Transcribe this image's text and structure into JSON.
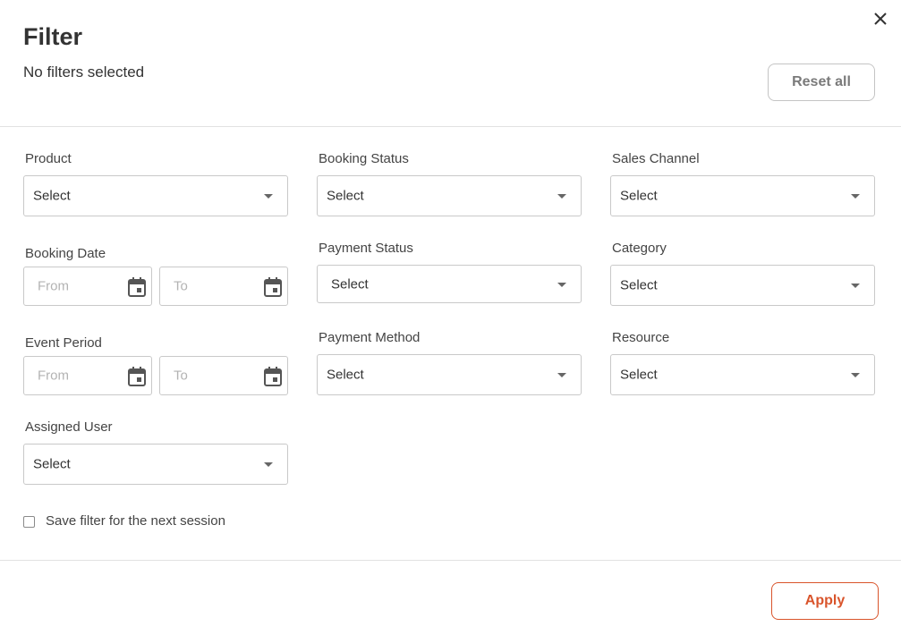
{
  "header": {
    "title": "Filter",
    "subtitle": "No filters selected",
    "reset_label": "Reset all"
  },
  "fields": {
    "product": {
      "label": "Product",
      "value": "Select"
    },
    "booking_status": {
      "label": "Booking Status",
      "value": "Select"
    },
    "sales_channel": {
      "label": "Sales Channel",
      "value": "Select"
    },
    "booking_date": {
      "label": "Booking Date",
      "from_placeholder": "From",
      "to_placeholder": "To"
    },
    "payment_status": {
      "label": "Payment Status",
      "value": "Select"
    },
    "category": {
      "label": "Category",
      "value": "Select"
    },
    "event_period": {
      "label": "Event Period",
      "from_placeholder": "From",
      "to_placeholder": "To"
    },
    "payment_method": {
      "label": "Payment Method",
      "value": "Select"
    },
    "resource": {
      "label": "Resource",
      "value": "Select"
    },
    "assigned_user": {
      "label": "Assigned User",
      "value": "Select"
    }
  },
  "save_filter": {
    "label": "Save filter for the next session",
    "checked": false
  },
  "footer": {
    "apply_label": "Apply"
  },
  "colors": {
    "accent": "#d9542b",
    "border": "#c9c9c9",
    "divider": "#e2e2e2"
  },
  "icons": {
    "close": "close-icon",
    "calendar": "calendar-icon",
    "dropdown": "chevron-down-icon"
  }
}
